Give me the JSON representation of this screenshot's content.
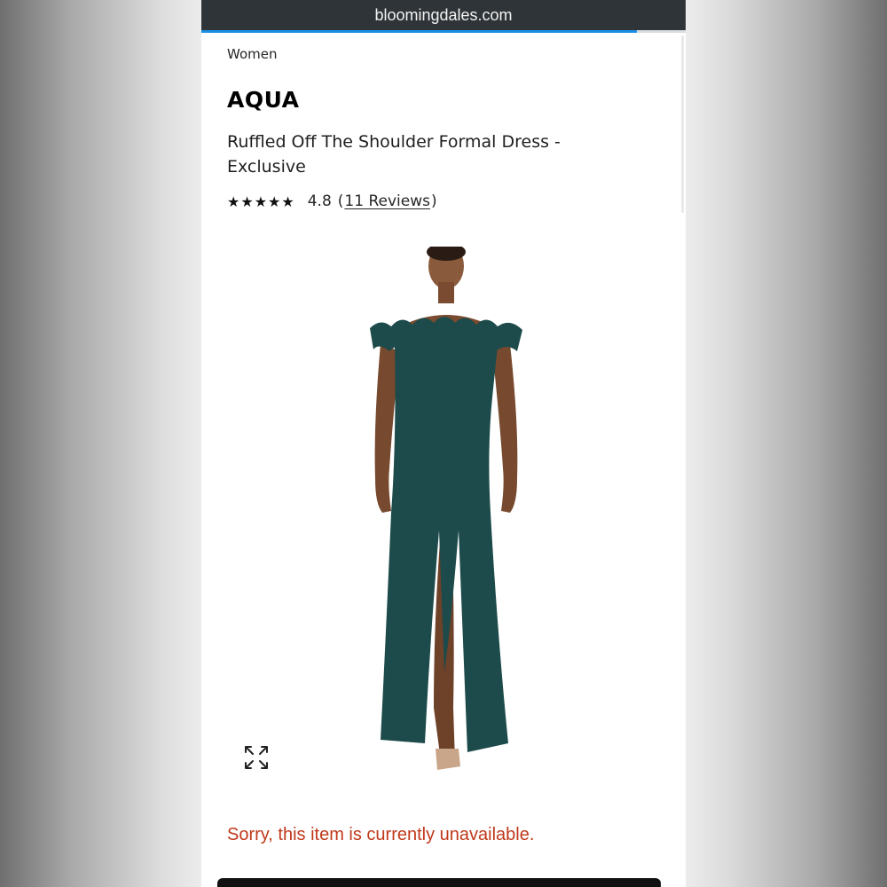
{
  "browser": {
    "url": "bloomingdales.com",
    "load_progress": 0.9
  },
  "breadcrumb": "Women",
  "product": {
    "brand": "AQUA",
    "title": "Ruffled Off The Shoulder Formal Dress - Exclusive",
    "rating": {
      "stars_display": "★★★★★",
      "score": "4.8",
      "reviews_label": "11 Reviews"
    },
    "image_subject": "model wearing dark teal off-the-shoulder ruffled gown",
    "dress_color": "#1d4a4a",
    "availability_message": "Sorry, this item is currently unavailable."
  },
  "icons": {
    "expand": "expand-arrows-icon",
    "stars": "star-icon"
  },
  "colors": {
    "urlbar_bg": "#2f3438",
    "progress": "#1b8fe6",
    "error_text": "#c0391b"
  }
}
